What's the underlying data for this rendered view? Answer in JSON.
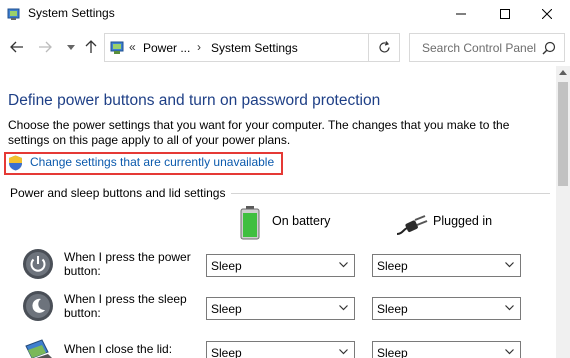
{
  "window": {
    "title": "System Settings"
  },
  "nav": {
    "address": {
      "prefix": "«",
      "crumbs": [
        "Power ...",
        "System Settings"
      ],
      "separator": "›"
    },
    "search_placeholder": "Search Control Panel"
  },
  "content": {
    "heading": "Define power buttons and turn on password protection",
    "description": "Choose the power settings that you want for your computer. The changes that you make to the settings on this page apply to all of your power plans.",
    "change_link": "Change settings that are currently unavailable",
    "group_title": "Power and sleep buttons and lid settings",
    "columns": {
      "battery": "On battery",
      "plugged": "Plugged in"
    },
    "rows": [
      {
        "label": "When I press the power button:",
        "battery": "Sleep",
        "plugged": "Sleep"
      },
      {
        "label": "When I press the sleep button:",
        "battery": "Sleep",
        "plugged": "Sleep"
      },
      {
        "label": "When I close the lid:",
        "battery": "Sleep",
        "plugged": "Sleep"
      }
    ]
  },
  "colors": {
    "heading": "#1e3f86",
    "link": "#0b5aad",
    "highlight_box": "#e53935"
  }
}
